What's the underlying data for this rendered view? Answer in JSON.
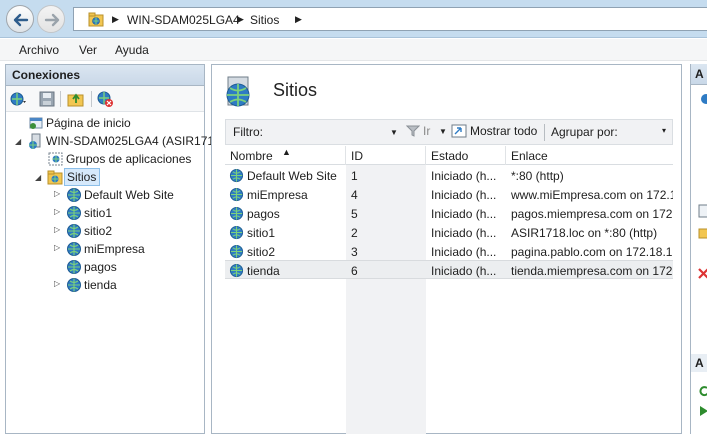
{
  "address": {
    "crumbs": [
      "WIN-SDAM025LGA4",
      "Sitios"
    ]
  },
  "menu": [
    "Archivo",
    "Ver",
    "Ayuda"
  ],
  "left_panel": {
    "title": "Conexiones",
    "tree": [
      {
        "label": "Página de inicio",
        "icon": "home-page-icon"
      },
      {
        "label": "WIN-SDAM025LGA4 (ASIR171",
        "icon": "server-icon"
      },
      {
        "label": "Grupos de aplicaciones",
        "icon": "app-pools-icon"
      },
      {
        "label": "Sitios",
        "icon": "sites-folder-icon"
      },
      {
        "label": "Default Web Site",
        "icon": "globe-icon"
      },
      {
        "label": "sitio1",
        "icon": "globe-icon"
      },
      {
        "label": "sitio2",
        "icon": "globe-icon"
      },
      {
        "label": "miEmpresa",
        "icon": "globe-icon"
      },
      {
        "label": "pagos",
        "icon": "globe-icon"
      },
      {
        "label": "tienda",
        "icon": "globe-icon"
      }
    ]
  },
  "center": {
    "title": "Sitios",
    "filter_label": "Filtro:",
    "filter_value": "",
    "go_label": "Ir",
    "show_all_label": "Mostrar todo",
    "group_by_label": "Agrupar por:",
    "columns": [
      "Nombre",
      "ID",
      "Estado",
      "Enlace"
    ],
    "rows": [
      {
        "name": "Default Web Site",
        "id": "1",
        "state": "Iniciado (h...",
        "binding": "*:80 (http)"
      },
      {
        "name": "miEmpresa",
        "id": "4",
        "state": "Iniciado (h...",
        "binding": "www.miEmpresa.com on 172.1"
      },
      {
        "name": "pagos",
        "id": "5",
        "state": "Iniciado (h...",
        "binding": "pagos.miempresa.com on 172."
      },
      {
        "name": "sitio1",
        "id": "2",
        "state": "Iniciado (h...",
        "binding": "ASIR1718.loc on *:80 (http)"
      },
      {
        "name": "sitio2",
        "id": "3",
        "state": "Iniciado (h...",
        "binding": "pagina.pablo.com on 172.18.17"
      },
      {
        "name": "tienda",
        "id": "6",
        "state": "Iniciado (h...",
        "binding": "tienda.miempresa.com on 172"
      }
    ]
  },
  "right_panel": {
    "title": "A",
    "section2": "A"
  },
  "colors": {
    "title_bar": "#c5dcef",
    "panel_header": "#c9d8e8",
    "selection": "#d6e9fb",
    "border": "#a8b6c4"
  }
}
